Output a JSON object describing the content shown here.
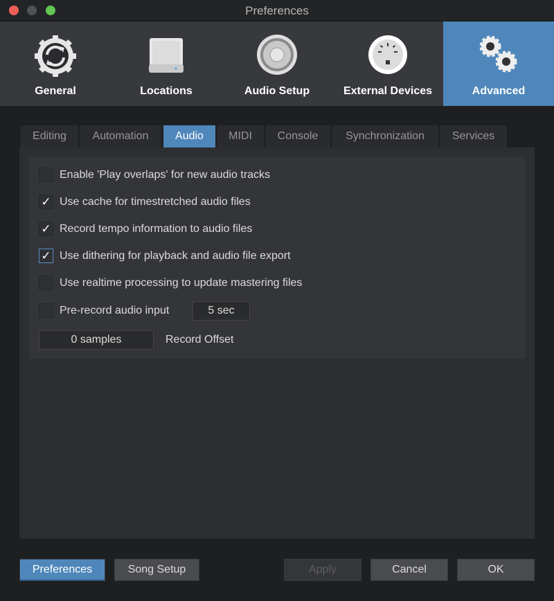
{
  "window": {
    "title": "Preferences"
  },
  "toolbar": {
    "items": [
      {
        "label": "General",
        "icon": "gear-sync-icon"
      },
      {
        "label": "Locations",
        "icon": "drive-icon"
      },
      {
        "label": "Audio Setup",
        "icon": "speaker-icon"
      },
      {
        "label": "External Devices",
        "icon": "midi-port-icon"
      },
      {
        "label": "Advanced",
        "icon": "gears-icon",
        "selected": true
      }
    ]
  },
  "tabs": [
    {
      "label": "Editing"
    },
    {
      "label": "Automation"
    },
    {
      "label": "Audio",
      "selected": true
    },
    {
      "label": "MIDI"
    },
    {
      "label": "Console"
    },
    {
      "label": "Synchronization"
    },
    {
      "label": "Services"
    }
  ],
  "options": [
    {
      "label": "Enable 'Play overlaps' for new audio tracks",
      "checked": false
    },
    {
      "label": "Use cache for timestretched audio files",
      "checked": true
    },
    {
      "label": "Record tempo information to audio files",
      "checked": true
    },
    {
      "label": "Use dithering for playback and audio file export",
      "checked": true
    },
    {
      "label": "Use realtime processing to update mastering files",
      "checked": false
    },
    {
      "label": "Pre-record audio input",
      "checked": false
    }
  ],
  "prerecord_value": "5 sec",
  "record_offset": {
    "value": "0 samples",
    "label": "Record Offset"
  },
  "checkmark": "✓",
  "buttons": {
    "preferences": "Preferences",
    "song_setup": "Song Setup",
    "apply": "Apply",
    "cancel": "Cancel",
    "ok": "OK"
  },
  "colors": {
    "accent": "#4f87bb"
  }
}
